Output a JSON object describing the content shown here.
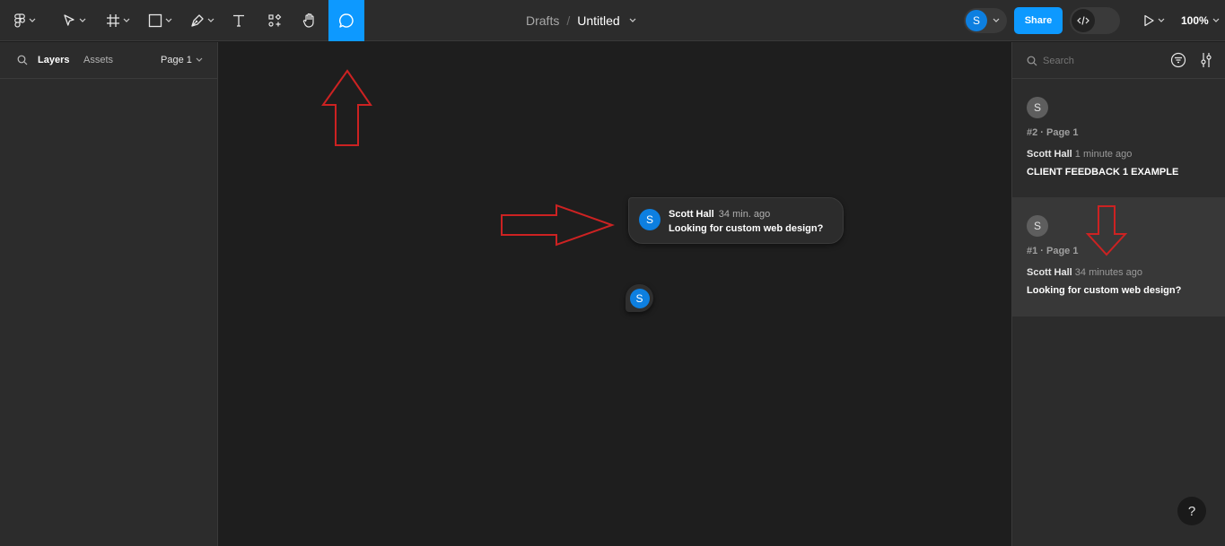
{
  "toolbar": {
    "tools": [
      {
        "icon": "figma-menu-icon"
      },
      {
        "icon": "move-tool-icon"
      },
      {
        "icon": "frame-tool-icon"
      },
      {
        "icon": "shape-tool-icon"
      },
      {
        "icon": "pen-tool-icon"
      },
      {
        "icon": "text-tool-icon"
      },
      {
        "icon": "resources-icon"
      },
      {
        "icon": "hand-tool-icon"
      },
      {
        "icon": "comment-tool-icon",
        "active": true
      }
    ],
    "breadcrumb": {
      "folder": "Drafts",
      "separator": "/",
      "file": "Untitled"
    },
    "user_avatar": "S",
    "share_label": "Share",
    "zoom": "100%",
    "accent": "#0d99ff"
  },
  "left_panel": {
    "tabs": {
      "layers": "Layers",
      "assets": "Assets"
    },
    "page_selector": "Page 1"
  },
  "canvas": {
    "comment_bubble": {
      "avatar": "S",
      "author": "Scott Hall",
      "time": "34 min. ago",
      "text": "Looking for custom web design?"
    },
    "pin_avatar": "S"
  },
  "right_panel": {
    "search_placeholder": "Search",
    "comments": [
      {
        "avatar": "S",
        "meta": "#2 · Page 1",
        "author": "Scott Hall",
        "time": "1 minute ago",
        "text": "CLIENT FEEDBACK 1 EXAMPLE"
      },
      {
        "avatar": "S",
        "meta": "#1 · Page 1",
        "author": "Scott Hall",
        "time": "34 minutes ago",
        "text": "Looking for custom web design?"
      }
    ]
  },
  "help_label": "?",
  "annotation_color": "#cc2222"
}
